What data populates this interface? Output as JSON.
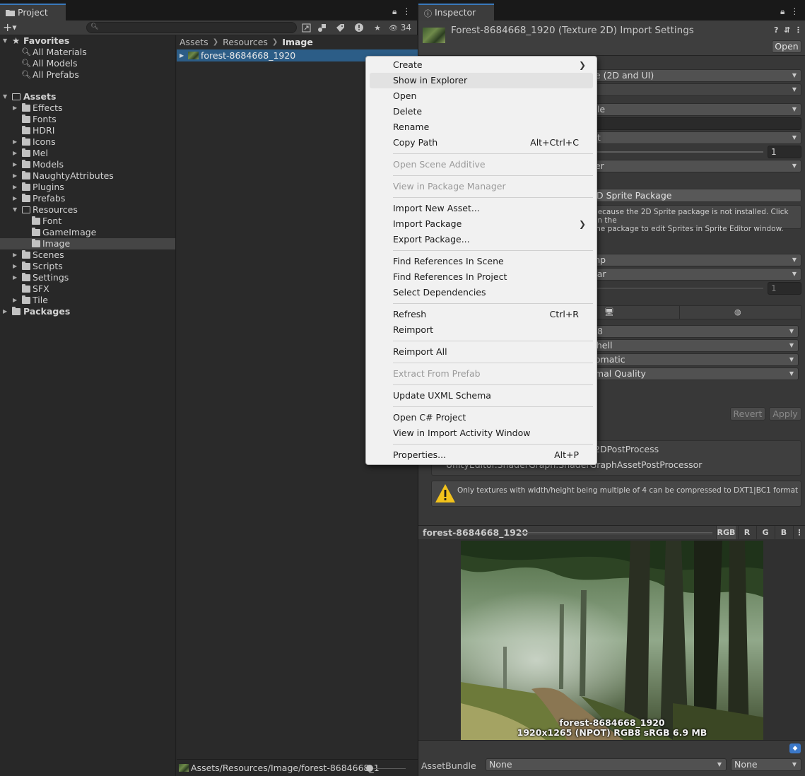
{
  "project_tab": {
    "title": "Project",
    "search_placeholder": "",
    "hidden_count": "34"
  },
  "tree": [
    {
      "label": "Favorites",
      "kind": "favorites-header"
    },
    {
      "label": "All Materials",
      "kind": "fav"
    },
    {
      "label": "All Models",
      "kind": "fav"
    },
    {
      "label": "All Prefabs",
      "kind": "fav"
    },
    {
      "label": "Assets",
      "kind": "root"
    },
    {
      "label": "Effects"
    },
    {
      "label": "Fonts"
    },
    {
      "label": "HDRI"
    },
    {
      "label": "Icons"
    },
    {
      "label": "Mel"
    },
    {
      "label": "Models"
    },
    {
      "label": "NaughtyAttributes"
    },
    {
      "label": "Plugins"
    },
    {
      "label": "Prefabs"
    },
    {
      "label": "Resources"
    },
    {
      "label": "Font"
    },
    {
      "label": "GameImage"
    },
    {
      "label": "Image"
    },
    {
      "label": "Scenes"
    },
    {
      "label": "Scripts"
    },
    {
      "label": "Settings"
    },
    {
      "label": "SFX"
    },
    {
      "label": "Tile"
    },
    {
      "label": "Packages",
      "kind": "root"
    }
  ],
  "breadcrumb": [
    "Assets",
    "Resources",
    "Image"
  ],
  "asset_name": "forest-8684668_1920",
  "footer_path": "Assets/Resources/Image/forest-8684668_1",
  "inspector": {
    "tab": "Inspector",
    "title": "Forest-8684668_1920 (Texture 2D) Import Settings",
    "open_label": "Open",
    "texture_type": "te (2D and UI)",
    "sprite_mode": "gle",
    "mesh_type": "nt",
    "pixels_value": "1",
    "pivot": "ter",
    "sprite_package_btn": "D Sprite Package",
    "sprite_help": "because the 2D Sprite package is not installed. Click on the\nthe package to edit Sprites in Sprite Editor window.",
    "wrap": "mp",
    "filter": "ear",
    "aniso": "1",
    "max_size": "48",
    "resize": "chell",
    "format": "tomatic",
    "compression": "rmal Quality",
    "revert_label": "Revert",
    "apply_label": "Apply",
    "postprocess_1": "2DPostProcess",
    "postprocess_2": "UnityEditor.ShaderGraph.ShaderGraphAssetPostProcessor",
    "warning": "Only textures with width/height being multiple of 4 can be compressed to DXT1|BC1 format",
    "preview_name": "forest-8684668_1920",
    "channels": [
      "RGB",
      "R",
      "G",
      "B"
    ],
    "img_caption_1": "forest-8684668_1920",
    "img_caption_2": "1920x1265 (NPOT)  RGB8 sRGB  6.9 MB",
    "asset_bundle_label": "AssetBundle",
    "bundle_value": "None",
    "variant_value": "None"
  },
  "menu": [
    {
      "label": "Create",
      "submenu": true
    },
    {
      "label": "Show in Explorer",
      "highlight": true
    },
    {
      "label": "Open"
    },
    {
      "label": "Delete"
    },
    {
      "label": "Rename"
    },
    {
      "label": "Copy Path",
      "shortcut": "Alt+Ctrl+C"
    },
    {
      "label": "Open Scene Additive",
      "disabled": true
    },
    {
      "label": "View in Package Manager",
      "disabled": true
    },
    {
      "label": "Import New Asset..."
    },
    {
      "label": "Import Package",
      "submenu": true
    },
    {
      "label": "Export Package..."
    },
    {
      "label": "Find References In Scene"
    },
    {
      "label": "Find References In Project"
    },
    {
      "label": "Select Dependencies"
    },
    {
      "label": "Refresh",
      "shortcut": "Ctrl+R"
    },
    {
      "label": "Reimport"
    },
    {
      "label": "Reimport All"
    },
    {
      "label": "Extract From Prefab",
      "disabled": true
    },
    {
      "label": "Update UXML Schema"
    },
    {
      "label": "Open C# Project"
    },
    {
      "label": "View in Import Activity Window"
    },
    {
      "label": "Properties...",
      "shortcut": "Alt+P"
    }
  ]
}
